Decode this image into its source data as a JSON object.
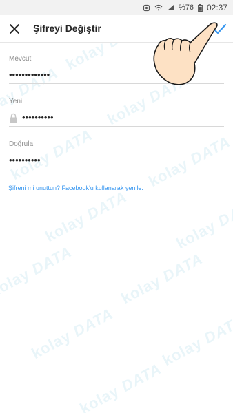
{
  "status_bar": {
    "battery": "%76",
    "time": "02:37",
    "icons": [
      "notification-icon",
      "wifi-icon",
      "signal-icon",
      "battery-icon"
    ]
  },
  "header": {
    "title": "Şifreyi Değiştir",
    "close_icon": "close-icon",
    "confirm_icon": "checkmark-icon",
    "accent_color": "#3897f0"
  },
  "form": {
    "current": {
      "label": "Mevcut",
      "value": "•••••••••••••"
    },
    "new": {
      "label": "Yeni",
      "value": "••••••••••"
    },
    "confirm": {
      "label": "Doğrula",
      "value": "••••••••••"
    }
  },
  "forgot_link": "Şifreni mi unuttun? Facebook'u kullanarak yenile.",
  "watermark": {
    "brand": "kolay",
    "brand_suffix": "DATA"
  }
}
